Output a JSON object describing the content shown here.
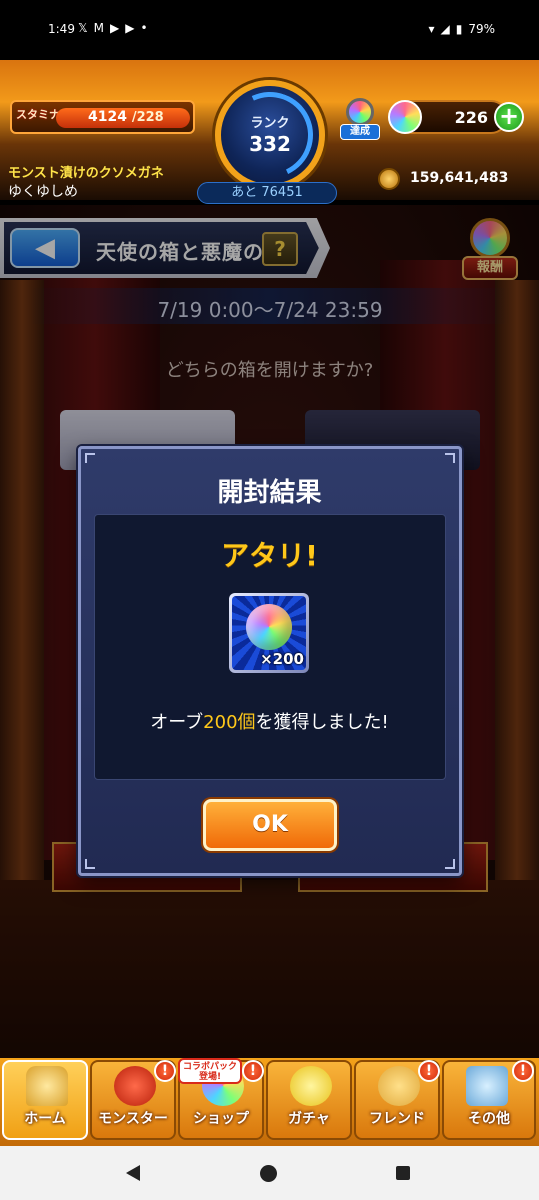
{
  "status_bar": {
    "time": "1:49",
    "notification_icons": [
      "𝕏",
      "M",
      "▶",
      "▶",
      "•"
    ],
    "battery": "79%"
  },
  "header": {
    "stamina_label": "スタミナ",
    "stamina_current": "4124",
    "stamina_max": "/228",
    "rank_label": "ランク",
    "rank_value": "332",
    "rank_next": "あと 76451",
    "achievement_label": "達成",
    "orb_count": "226",
    "player_title": "モンスト漬けのクソメガネ",
    "player_name": "ゆくゆしめ",
    "coin_count": "159,641,483"
  },
  "event": {
    "title": "天使の箱と悪魔の箱",
    "help_label": "?",
    "reward_label": "報酬",
    "period": "7/19 0:00〜7/24 23:59",
    "question": "どちらの箱を開けますか?"
  },
  "dialog": {
    "title": "開封結果",
    "result": "アタリ!",
    "reward_quantity": "×200",
    "message_prefix": "オーブ",
    "message_highlight": "200個",
    "message_suffix": "を獲得しました!",
    "ok_label": "OK"
  },
  "bottom_nav": {
    "items": [
      {
        "label": "ホーム"
      },
      {
        "label": "モンスター"
      },
      {
        "label": "ショップ"
      },
      {
        "label": "ガチャ"
      },
      {
        "label": "フレンド"
      },
      {
        "label": "その他"
      }
    ],
    "collab_tag": "コラボパック登場!",
    "badge": "!"
  },
  "colors": {
    "accent_orange": "#f29a1a",
    "result_gold": "#ffc81a",
    "dialog_bg": "#2f3b6a"
  }
}
